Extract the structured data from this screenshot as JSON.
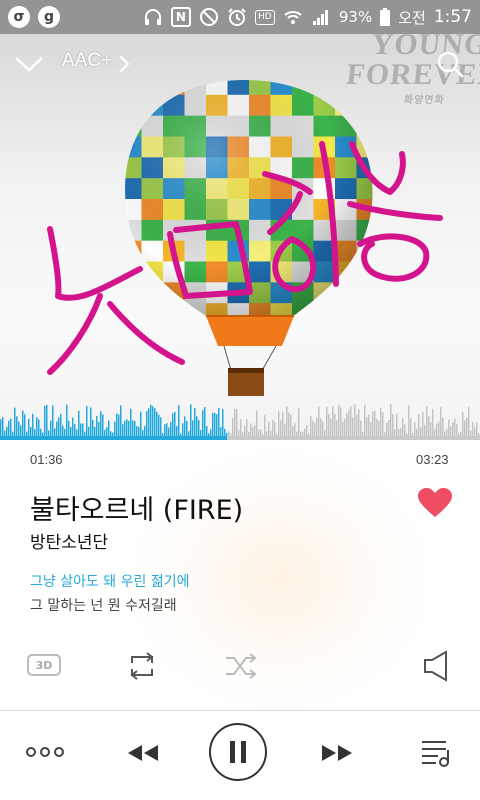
{
  "status_bar": {
    "app1_glyph": "σ",
    "app2_glyph": "g",
    "battery": "93%",
    "time_label": "오전",
    "time": "1:57",
    "hd_label": "HD",
    "nfc_label": "N"
  },
  "header": {
    "codec": "AAC+",
    "watermark_line1": "YOUNG",
    "watermark_line2": "FOREVER",
    "watermark_line3": "화양연화"
  },
  "player": {
    "elapsed": "01:36",
    "duration": "03:23",
    "progress": 0.473,
    "song_title": "불타오르네 (FIRE)",
    "artist": "방탄소년단",
    "favorited": true,
    "lyric_current": "그냥 살아도 돼 우린 젊기에",
    "lyric_next": "그 말하는 넌 뭔 수저길래",
    "effect_3d_label": "3D"
  },
  "colors": {
    "accent": "#23a9dc",
    "heart": "#ee4d64",
    "handwriting": "#d4148c"
  },
  "icons": [
    "chevron-down-icon",
    "search-icon",
    "heart-icon",
    "3d-icon",
    "repeat-icon",
    "shuffle-icon",
    "speaker-icon",
    "more-icon",
    "rewind-icon",
    "pause-icon",
    "fast-forward-icon",
    "playlist-icon"
  ]
}
